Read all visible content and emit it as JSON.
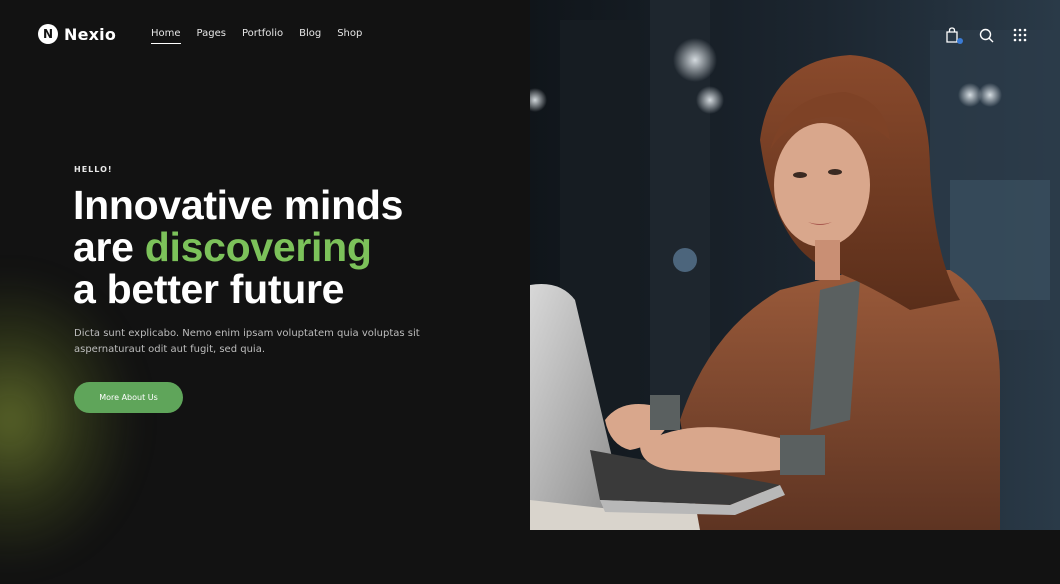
{
  "brand": {
    "name": "Nexio",
    "mark": "N"
  },
  "nav": {
    "items": [
      {
        "label": "Home",
        "active": true
      },
      {
        "label": "Pages",
        "active": false
      },
      {
        "label": "Portfolio",
        "active": false
      },
      {
        "label": "Blog",
        "active": false
      },
      {
        "label": "Shop",
        "active": false
      }
    ]
  },
  "header_icons": [
    "shopping-bag-icon",
    "search-icon",
    "grid-menu-icon"
  ],
  "hero": {
    "eyebrow": "HELLO!",
    "headline_line1": "Innovative minds",
    "headline_line2_pre": "are ",
    "headline_line2_accent": "discovering",
    "headline_line3": "a better future",
    "description": "Dicta sunt explicabo. Nemo enim ipsam voluptatem quia voluptas sit aspernaturaut odit aut fugit, sed quia.",
    "cta_label": "More About Us"
  },
  "colors": {
    "background": "#121212",
    "accent": "#7cc25a",
    "button": "#5fa55a",
    "cart_badge": "#3a7bd5"
  }
}
